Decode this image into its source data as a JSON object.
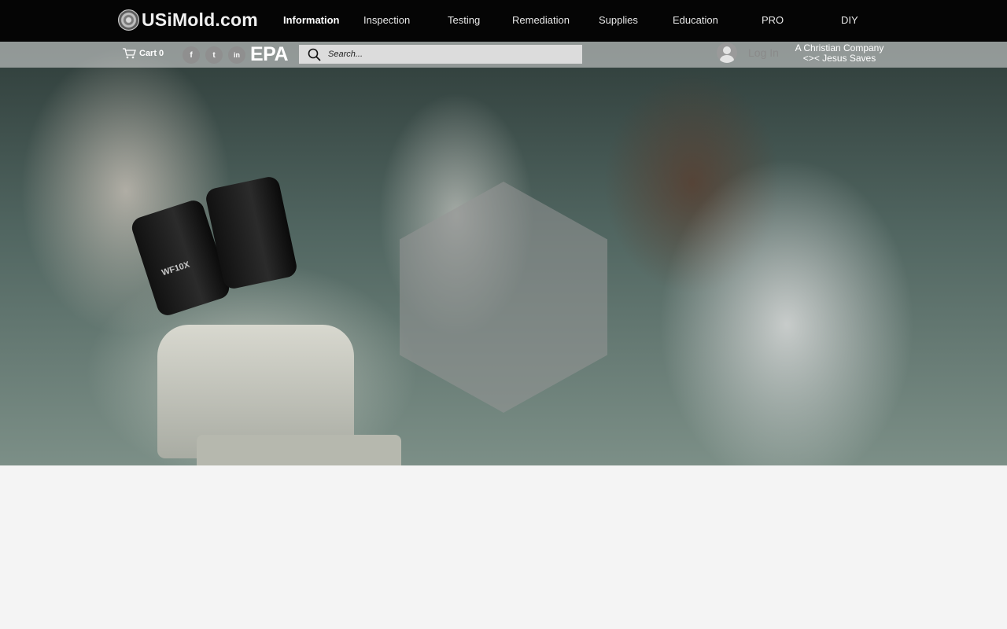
{
  "site": {
    "logo_text": "USiMold.com"
  },
  "nav": {
    "items": [
      {
        "label": "Information",
        "active": true
      },
      {
        "label": "Inspection",
        "active": false
      },
      {
        "label": "Testing",
        "active": false
      },
      {
        "label": "Remediation",
        "active": false
      },
      {
        "label": "Supplies",
        "active": false
      },
      {
        "label": "Education",
        "active": false
      },
      {
        "label": "PRO",
        "active": false
      },
      {
        "label": "DIY",
        "active": false
      }
    ]
  },
  "subbar": {
    "cart_label": "Cart 0",
    "social": [
      {
        "icon": "facebook-icon",
        "glyph": "f"
      },
      {
        "icon": "twitter-icon",
        "glyph": "t"
      },
      {
        "icon": "linkedin-icon",
        "glyph": "in"
      }
    ],
    "epa_label": "EPA",
    "search_placeholder": "Search...",
    "login_label": "Log In",
    "tagline_line1": "A Christian Company",
    "tagline_line2": "<>< Jesus Saves"
  },
  "hero": {
    "microscope_label": "WF10X"
  },
  "colors": {
    "topbar": "#050505",
    "page_background": "#f4f4f4",
    "search_background": "#dcdcdc"
  }
}
